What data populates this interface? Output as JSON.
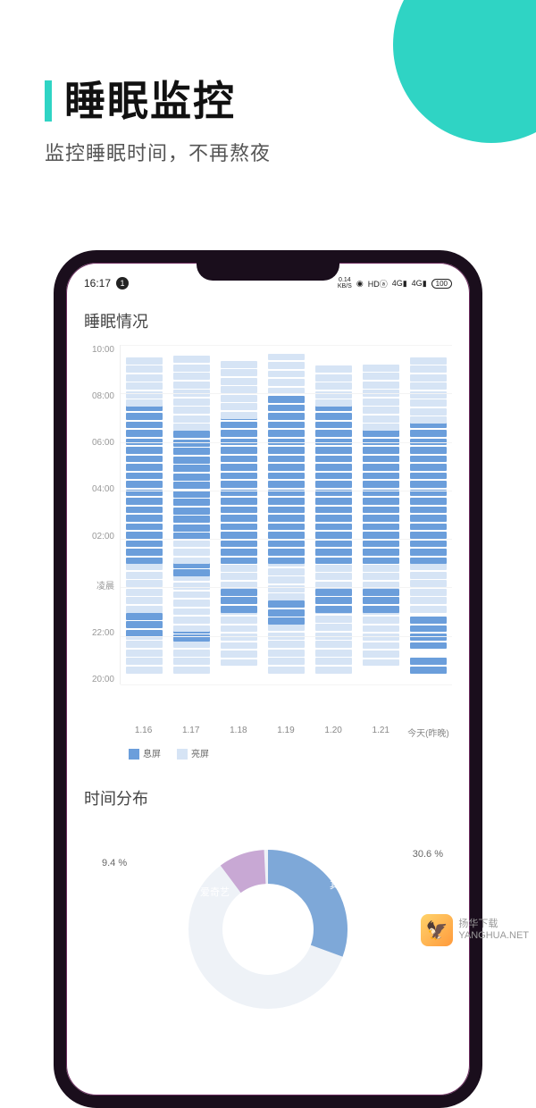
{
  "hero": {
    "title": "睡眠监控",
    "subtitle": "监控睡眠时间，不再熬夜"
  },
  "statusbar": {
    "time": "16:17",
    "notif": "1",
    "kbs_top": "0.14",
    "kbs_bot": "KB/S",
    "hd": "HDⓐ",
    "net1": "4G",
    "net2": "4G",
    "batt": "100"
  },
  "section1_title": "睡眠情况",
  "section2_title": "时间分布",
  "chart_data": {
    "type": "bar",
    "y_ticks": [
      "10:00",
      "08:00",
      "06:00",
      "04:00",
      "02:00",
      "凌晨",
      "22:00",
      "20:00"
    ],
    "x_categories": [
      "1.16",
      "1.17",
      "1.18",
      "1.19",
      "1.20",
      "1.21",
      "今天(昨晚)"
    ],
    "y_range_hours": [
      20,
      34
    ],
    "legend": [
      {
        "name": "息屏",
        "color": "#6b9edb"
      },
      {
        "name": "亮屏",
        "color": "#d6e4f5"
      }
    ],
    "columns": [
      {
        "day": "1.16",
        "segments": [
          {
            "from": 20.5,
            "to": 22.0,
            "state": "off"
          },
          {
            "from": 22.0,
            "to": 23.0,
            "state": "on"
          },
          {
            "from": 23.0,
            "to": 25.0,
            "state": "off"
          },
          {
            "from": 25.0,
            "to": 31.5,
            "state": "on"
          },
          {
            "from": 31.5,
            "to": 33.5,
            "state": "off"
          }
        ]
      },
      {
        "day": "1.17",
        "segments": [
          {
            "from": 20.5,
            "to": 21.8,
            "state": "off"
          },
          {
            "from": 21.8,
            "to": 22.2,
            "state": "on"
          },
          {
            "from": 22.2,
            "to": 24.5,
            "state": "off"
          },
          {
            "from": 24.5,
            "to": 25.0,
            "state": "on"
          },
          {
            "from": 25.0,
            "to": 26.0,
            "state": "off"
          },
          {
            "from": 26.0,
            "to": 30.5,
            "state": "on"
          },
          {
            "from": 30.5,
            "to": 33.5,
            "state": "off"
          }
        ]
      },
      {
        "day": "1.18",
        "segments": [
          {
            "from": 20.8,
            "to": 23.0,
            "state": "off"
          },
          {
            "from": 23.0,
            "to": 24.0,
            "state": "on"
          },
          {
            "from": 24.0,
            "to": 25.0,
            "state": "off"
          },
          {
            "from": 25.0,
            "to": 31.0,
            "state": "on"
          },
          {
            "from": 31.0,
            "to": 33.3,
            "state": "off"
          }
        ]
      },
      {
        "day": "1.19",
        "segments": [
          {
            "from": 20.5,
            "to": 22.5,
            "state": "off"
          },
          {
            "from": 22.5,
            "to": 23.5,
            "state": "on"
          },
          {
            "from": 23.5,
            "to": 25.0,
            "state": "off"
          },
          {
            "from": 25.0,
            "to": 32.0,
            "state": "on"
          },
          {
            "from": 32.0,
            "to": 33.5,
            "state": "off"
          }
        ]
      },
      {
        "day": "1.20",
        "segments": [
          {
            "from": 20.5,
            "to": 23.0,
            "state": "off"
          },
          {
            "from": 23.0,
            "to": 24.0,
            "state": "on"
          },
          {
            "from": 24.0,
            "to": 25.0,
            "state": "off"
          },
          {
            "from": 25.0,
            "to": 31.5,
            "state": "on"
          },
          {
            "from": 31.5,
            "to": 33.0,
            "state": "off"
          }
        ]
      },
      {
        "day": "1.21",
        "segments": [
          {
            "from": 20.8,
            "to": 23.0,
            "state": "off"
          },
          {
            "from": 23.0,
            "to": 24.0,
            "state": "on"
          },
          {
            "from": 24.0,
            "to": 25.0,
            "state": "off"
          },
          {
            "from": 25.0,
            "to": 30.5,
            "state": "on"
          },
          {
            "from": 30.5,
            "to": 33.2,
            "state": "off"
          }
        ]
      },
      {
        "day": "今天(昨晚)",
        "segments": [
          {
            "from": 20.5,
            "to": 21.2,
            "state": "on"
          },
          {
            "from": 21.5,
            "to": 22.8,
            "state": "on"
          },
          {
            "from": 23.0,
            "to": 25.0,
            "state": "off"
          },
          {
            "from": 25.0,
            "to": 30.8,
            "state": "on"
          },
          {
            "from": 30.8,
            "to": 33.5,
            "state": "off"
          }
        ]
      }
    ]
  },
  "pie": {
    "type": "pie",
    "slices": [
      {
        "name": "其它",
        "percent": 30.6,
        "color": "#7ea8d8"
      },
      {
        "name": "爱奇艺",
        "percent": 9.4,
        "color": "#c8a8d4"
      }
    ],
    "labels": {
      "left": "9.4 %",
      "right": "30.6 %",
      "seg_left": "爱奇艺",
      "seg_right": "其它"
    }
  },
  "watermark": {
    "brand": "扬华下载",
    "url": "YANGHUA.NET"
  }
}
